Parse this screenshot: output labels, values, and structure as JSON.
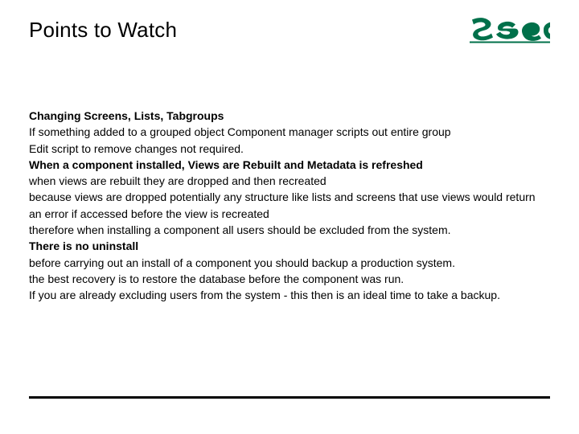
{
  "title": "Points to Watch",
  "logo": {
    "name": "sage-logo",
    "text": "sage",
    "color": "#00704a"
  },
  "sections": [
    {
      "heading": "Changing Screens, Lists, Tabgroups",
      "lines": [
        "If something added to a grouped object Component manager scripts out entire group",
        "Edit script to remove changes not required."
      ]
    },
    {
      "heading": "When a component installed, Views are Rebuilt and Metadata is refreshed",
      "lines": [
        "when views are rebuilt  they are dropped and then recreated",
        "because views are dropped potentially any structure like lists and screens that use views would return an error if accessed before the view is recreated",
        "therefore when installing a component all users should be excluded from the system."
      ]
    },
    {
      "heading": "There is no uninstall",
      "lines": [
        "before carrying out an install of a component you should backup a production system.",
        "the best recovery is to restore the database before the component was run.",
        "If you are already excluding users from the system - this then is an ideal time to take a backup."
      ]
    }
  ]
}
